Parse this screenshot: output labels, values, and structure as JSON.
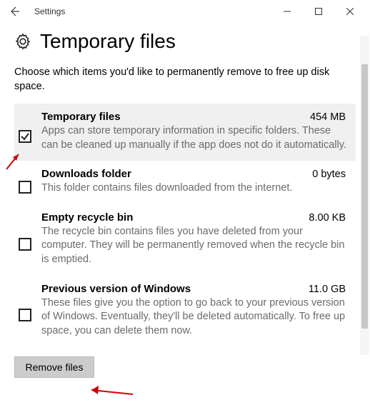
{
  "window": {
    "title": "Settings"
  },
  "page": {
    "heading": "Temporary files",
    "intro": "Choose which items you'd like to permanently remove to free up disk space."
  },
  "items": [
    {
      "title": "Temporary files",
      "size": "454 MB",
      "desc": "Apps can store temporary information in specific folders. These can be cleaned up manually if the app does not do it automatically.",
      "checked": true,
      "selected": true
    },
    {
      "title": "Downloads folder",
      "size": "0 bytes",
      "desc": "This folder contains files downloaded from the internet.",
      "checked": false,
      "selected": false
    },
    {
      "title": "Empty recycle bin",
      "size": "8.00 KB",
      "desc": "The recycle bin contains files you have deleted from your computer. They will be permanently removed when the recycle bin is emptied.",
      "checked": false,
      "selected": false
    },
    {
      "title": "Previous version of Windows",
      "size": "11.0 GB",
      "desc": "These files give you the option to go back to your previous version of Windows. Eventually, they'll be deleted automatically. To free up space, you can delete them now.",
      "checked": false,
      "selected": false
    }
  ],
  "button": {
    "remove": "Remove files"
  },
  "colors": {
    "arrow": "#d40000"
  }
}
